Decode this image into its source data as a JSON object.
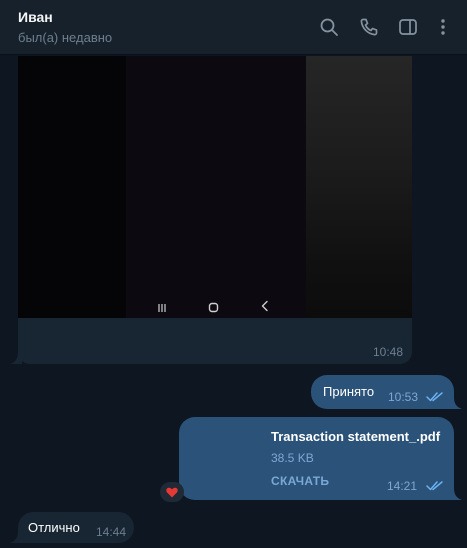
{
  "header": {
    "name": "Иван",
    "status": "был(а) недавно",
    "icons": [
      "search-icon",
      "phone-icon",
      "sidebar-toggle-icon",
      "more-vertical-icon"
    ]
  },
  "messages": {
    "photo": {
      "time": "10:48",
      "nav_icons": [
        "recent-apps-icon",
        "home-icon",
        "back-icon"
      ]
    },
    "outgoing_text": {
      "text": "Принято",
      "time": "10:53"
    },
    "file": {
      "name": "Transaction statement_.pdf",
      "size": "38.5 KB",
      "action": "СКАЧАТЬ",
      "time": "14:21",
      "reaction": "❤️"
    },
    "incoming_text": {
      "text": "Отлично",
      "time": "14:44"
    }
  },
  "colors": {
    "header_bg": "#17212b",
    "chat_bg": "#0e1621",
    "outgoing_bubble": "#2b5278",
    "incoming_bubble": "#182533",
    "accent": "#7aa8d6",
    "muted": "#6d7f8f"
  }
}
